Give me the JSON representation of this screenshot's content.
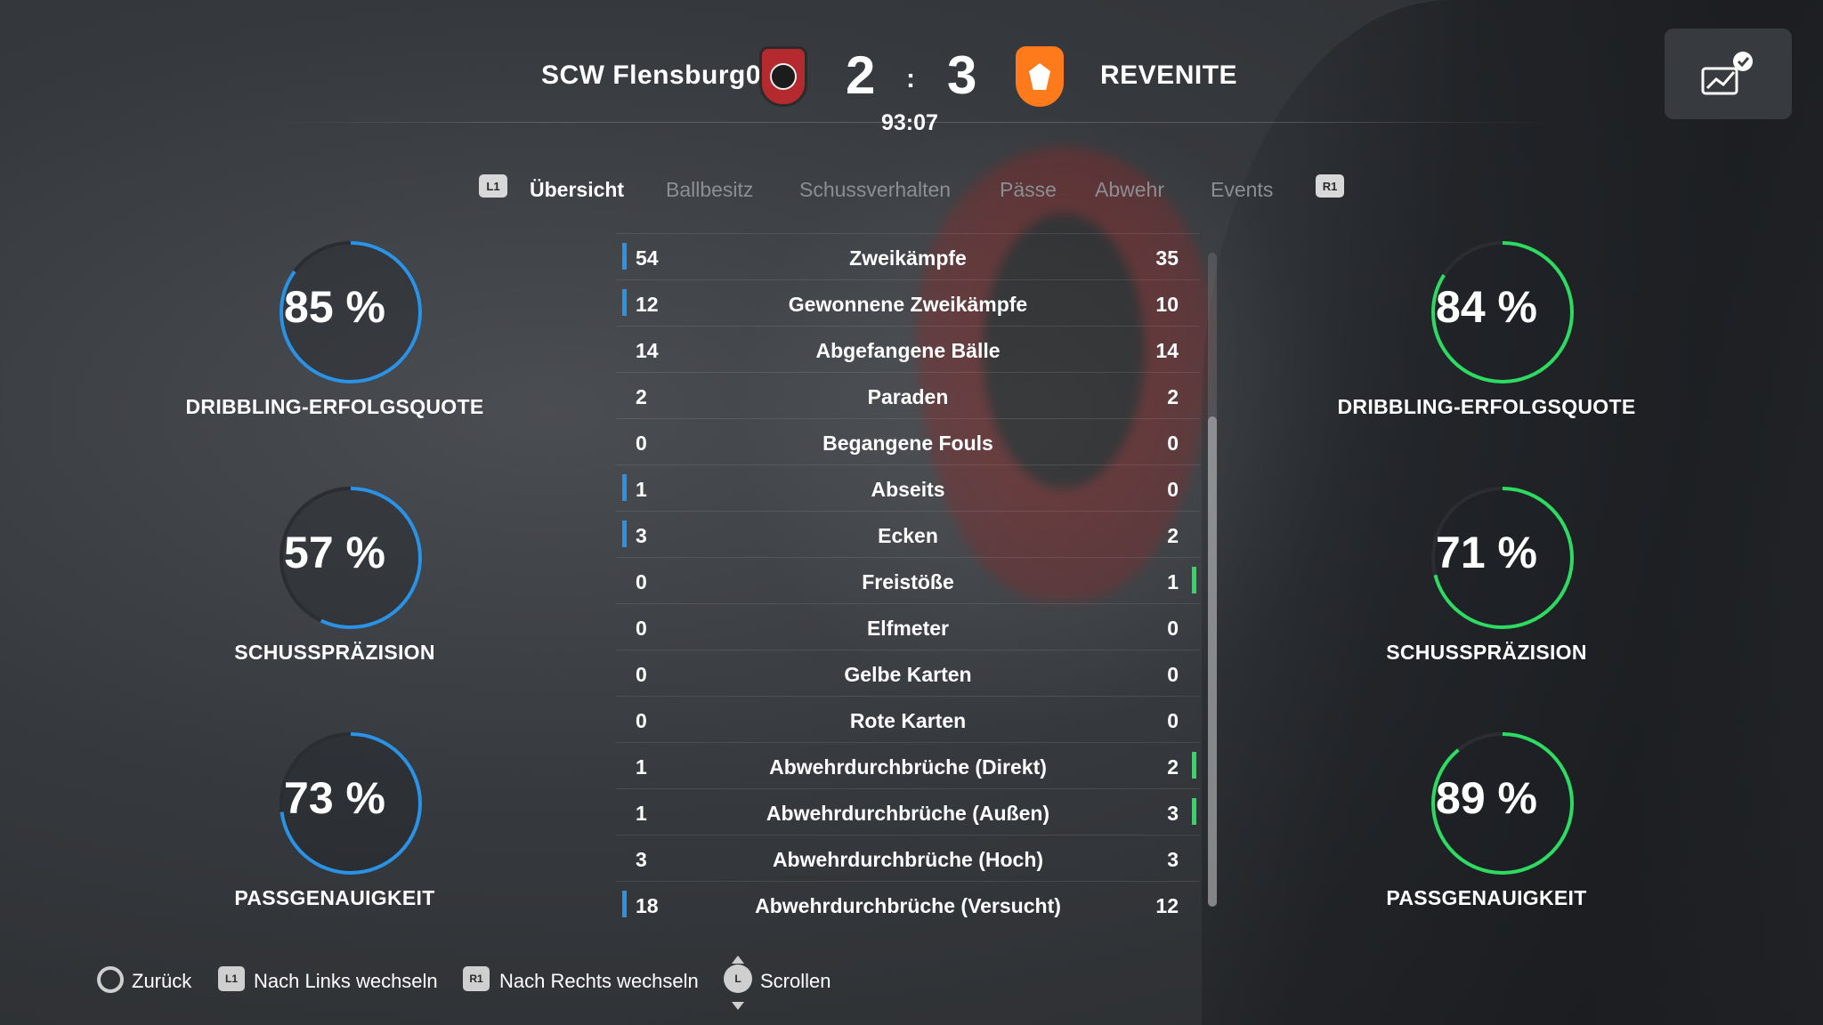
{
  "match": {
    "home_team": "SCW Flensburg08",
    "away_team": "REVENITE",
    "home_score": "2",
    "away_score": "3",
    "separator": ":",
    "clock": "93:07"
  },
  "tabs": {
    "left_button": "L1",
    "right_button": "R1",
    "items": [
      "Übersicht",
      "Ballbesitz",
      "Schussverhalten",
      "Pässe",
      "Abwehr",
      "Events"
    ],
    "active": "Übersicht"
  },
  "home_rings": [
    {
      "value": 85,
      "text": "85 %",
      "label": "DRIBBLING-ERFOLGSQUOTE"
    },
    {
      "value": 57,
      "text": "57 %",
      "label": "SCHUSSPRÄZISION"
    },
    {
      "value": 73,
      "text": "73 %",
      "label": "PASSGENAUIGKEIT"
    }
  ],
  "away_rings": [
    {
      "value": 84,
      "text": "84 %",
      "label": "DRIBBLING-ERFOLGSQUOTE"
    },
    {
      "value": 71,
      "text": "71 %",
      "label": "SCHUSSPRÄZISION"
    },
    {
      "value": 89,
      "text": "89 %",
      "label": "PASSGENAUIGKEIT"
    }
  ],
  "stats": [
    {
      "home": "54",
      "label": "Zweikämpfe",
      "away": "35",
      "lead": "home"
    },
    {
      "home": "12",
      "label": "Gewonnene Zweikämpfe",
      "away": "10",
      "lead": "home"
    },
    {
      "home": "14",
      "label": "Abgefangene Bälle",
      "away": "14",
      "lead": ""
    },
    {
      "home": "2",
      "label": "Paraden",
      "away": "2",
      "lead": ""
    },
    {
      "home": "0",
      "label": "Begangene Fouls",
      "away": "0",
      "lead": ""
    },
    {
      "home": "1",
      "label": "Abseits",
      "away": "0",
      "lead": "home"
    },
    {
      "home": "3",
      "label": "Ecken",
      "away": "2",
      "lead": "home"
    },
    {
      "home": "0",
      "label": "Freistöße",
      "away": "1",
      "lead": "away"
    },
    {
      "home": "0",
      "label": "Elfmeter",
      "away": "0",
      "lead": ""
    },
    {
      "home": "0",
      "label": "Gelbe Karten",
      "away": "0",
      "lead": ""
    },
    {
      "home": "0",
      "label": "Rote Karten",
      "away": "0",
      "lead": ""
    },
    {
      "home": "1",
      "label": "Abwehrdurchbrüche (Direkt)",
      "away": "2",
      "lead": "away"
    },
    {
      "home": "1",
      "label": "Abwehrdurchbrüche (Außen)",
      "away": "3",
      "lead": "away"
    },
    {
      "home": "3",
      "label": "Abwehrdurchbrüche (Hoch)",
      "away": "3",
      "lead": ""
    },
    {
      "home": "18",
      "label": "Abwehrdurchbrüche (Versucht)",
      "away": "12",
      "lead": "home"
    }
  ],
  "footer": {
    "back": "Zurück",
    "left_button": "L1",
    "left": "Nach Links wechseln",
    "right_button": "R1",
    "right": "Nach Rechts wechseln",
    "stick": "L",
    "scroll": "Scrollen"
  },
  "colors": {
    "home_accent": "#2a93e6",
    "away_accent": "#2ddb62",
    "ring_track": "#2b2d31"
  },
  "icons": {
    "corner_button": "stats-chart-check-icon",
    "back_button": "circle-button-icon",
    "scroll": "left-stick-icon"
  }
}
